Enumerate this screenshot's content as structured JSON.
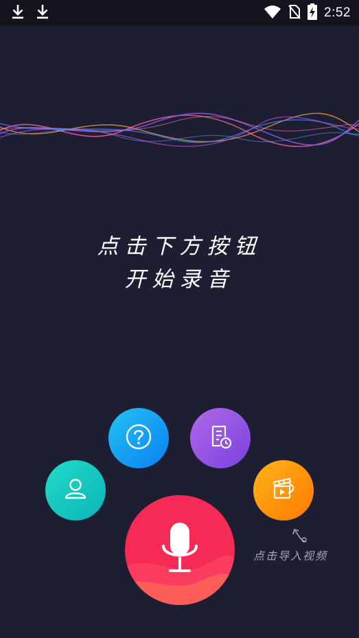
{
  "status_bar": {
    "time": "2:52",
    "icons": [
      "download-icon",
      "download-icon",
      "wifi-icon",
      "no-sim-icon",
      "battery-charging-icon"
    ]
  },
  "prompt": {
    "line1": "点击下方按钮",
    "line2": "开始录音"
  },
  "buttons": {
    "help": {
      "icon": "question-icon",
      "color": "#1aa6f4"
    },
    "history": {
      "icon": "history-list-icon",
      "color": "#9a55e6"
    },
    "profile": {
      "icon": "user-icon",
      "color": "#17c9c0"
    },
    "import_video": {
      "icon": "video-import-icon",
      "color": "#ff9a0a"
    },
    "record": {
      "icon": "microphone-icon",
      "color": "#f52a55"
    }
  },
  "import_hint": "点击导入视频"
}
